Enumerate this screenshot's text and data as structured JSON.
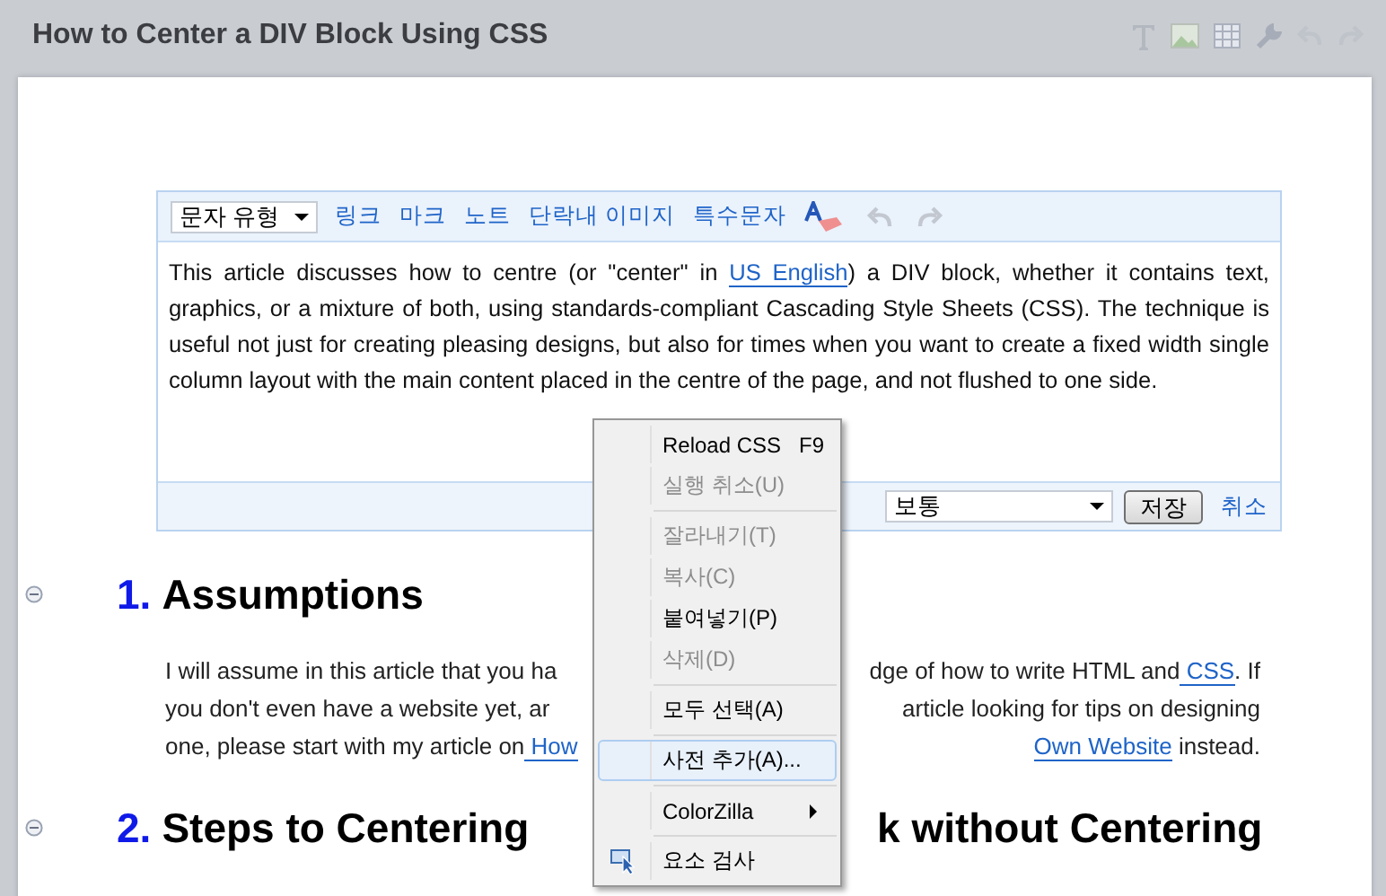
{
  "header": {
    "title": "How to Center a DIV Block Using CSS",
    "tools": [
      {
        "kind": "text"
      },
      {
        "kind": "image"
      },
      {
        "kind": "table"
      },
      {
        "kind": "wrench"
      },
      {
        "kind": "undo"
      },
      {
        "kind": "redo"
      }
    ]
  },
  "editor": {
    "style_select": "문자 유형",
    "toolbar_links": [
      "링크",
      "마크",
      "노트",
      "단락내 이미지",
      "특수문자"
    ],
    "undo_disabled": true,
    "redo_disabled": true,
    "text": [
      {
        "text": "This article discusses how to centre (or \"center\" in ",
        "kind": "text"
      },
      {
        "text": "US English",
        "kind": "link"
      },
      {
        "text": ") a DIV block, whether it contains text, graphics, or a mixture of both, using standards-compliant Cascading Style Sheets (CSS). The technique is useful not just for creating pleasing designs, but also for times when you want to create a fixed width single column layout with the main content placed in the centre of the page, and not flushed to one side.",
        "kind": "text"
      }
    ],
    "size_select": "보통",
    "save_button": "저장",
    "cancel_link": "취소"
  },
  "sections": [
    {
      "number": "1.",
      "heading": [
        {
          "text": "Assumptions"
        }
      ],
      "lines": [
        {
          "left": [
            {
              "text": "I will assume in this article that you ha",
              "kind": "text"
            }
          ],
          "right": [
            {
              "text": "dge of how to write HTML and",
              "kind": "text"
            },
            {
              "text": " CSS",
              "kind": "link"
            },
            {
              "text": ". If",
              "kind": "text"
            }
          ]
        },
        {
          "left": [
            {
              "text": "you don't even have a website yet, ar",
              "kind": "text"
            }
          ],
          "right": [
            {
              "text": "article looking for tips on designing",
              "kind": "text"
            }
          ]
        },
        {
          "left": [
            {
              "text": "one, please start with my article on",
              "kind": "text"
            },
            {
              "text": " How",
              "kind": "link"
            }
          ],
          "right": [
            {
              "text": "Own Website",
              "kind": "link"
            },
            {
              "text": " instead.",
              "kind": "text"
            }
          ]
        }
      ]
    },
    {
      "number": "2.",
      "heading": [
        {
          "text": "Steps to Centering"
        },
        {
          "text": "k without Centering"
        }
      ]
    }
  ],
  "context_menu": [
    {
      "kind": "item",
      "label": "Reload CSS",
      "shortcut": "F9",
      "disabled": false,
      "selected": false
    },
    {
      "kind": "item",
      "label": "실행 취소(U)",
      "disabled": true,
      "selected": false
    },
    {
      "kind": "separator"
    },
    {
      "kind": "item",
      "label": "잘라내기(T)",
      "disabled": true,
      "selected": false
    },
    {
      "kind": "item",
      "label": "복사(C)",
      "disabled": true,
      "selected": false
    },
    {
      "kind": "item",
      "label": "붙여넣기(P)",
      "disabled": false,
      "selected": false
    },
    {
      "kind": "item",
      "label": "삭제(D)",
      "disabled": true,
      "selected": false
    },
    {
      "kind": "separator"
    },
    {
      "kind": "item",
      "label": "모두 선택(A)",
      "disabled": false,
      "selected": false
    },
    {
      "kind": "separator"
    },
    {
      "kind": "item",
      "label": "사전 추가(A)...",
      "disabled": false,
      "selected": true
    },
    {
      "kind": "separator"
    },
    {
      "kind": "submenu",
      "label": "ColorZilla",
      "disabled": false,
      "selected": false
    },
    {
      "kind": "separator"
    },
    {
      "kind": "inspect",
      "label": "요소 검사",
      "disabled": false,
      "selected": false
    }
  ]
}
